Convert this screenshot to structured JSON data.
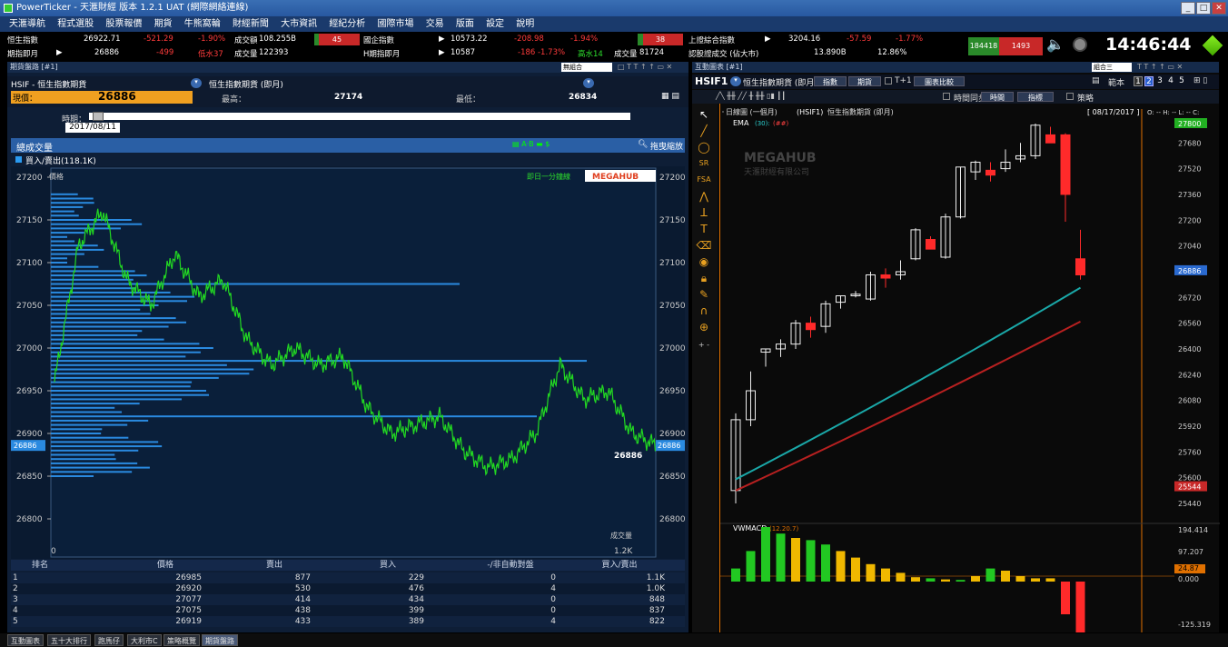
{
  "window": {
    "title": "PowerTicker - 天滙財經 版本 1.2.1 UAT (網際網絡連線)",
    "clock": "14:46:44"
  },
  "menu": [
    "天滙導航",
    "程式選股",
    "股票報價",
    "期貨",
    "牛熊窩輪",
    "財經新聞",
    "大市資訊",
    "經紀分析",
    "國際市場",
    "交易",
    "版面",
    "設定",
    "說明"
  ],
  "ticker": {
    "row1": {
      "l1": "恒生指數",
      "v1": "26922.71",
      "c1": "-521.29",
      "p1": "-1.90%",
      "t1": "成交額",
      "a1": "108.255B",
      "b1": "45",
      "l2": "國企指數",
      "v2": "10573.22",
      "c2": "-208.98",
      "p2": "-1.94%",
      "b2": "38",
      "l3": "上證綜合指數",
      "v3": "3204.16",
      "c3": "-57.59",
      "p3": "-1.77%"
    },
    "row2": {
      "l1": "期指即月",
      "v1": "26886",
      "c1": "-499",
      "p1": "低水37",
      "t1": "成交量",
      "a1": "122393",
      "l2": "H期指即月",
      "v2": "10587",
      "c2": "-186 -1.73%",
      "p2": "高水14",
      "t2": "成交量",
      "a2": "81724",
      "l3": "認股證成交 (佔大市)",
      "v3": "13.890B",
      "p3": "12.86%"
    },
    "counts": {
      "up": "184418",
      "down": "1493"
    }
  },
  "left": {
    "panel_title": "期貨盤路 [#1]",
    "combo": "無組合",
    "symbol": "HSIF - 恒生指數期貨",
    "name": "恒生指數期貨 (即月)",
    "price_label": "現價：",
    "price": "26886",
    "high_label": "最高：",
    "high": "27174",
    "low_label": "最低：",
    "low": "26834",
    "date_label": "時期：",
    "date": "2017/08/11",
    "section": "總成交量",
    "zoom_label": "拖曳縮放",
    "legend": "買入/賣出(118.1K)",
    "y_title": "價格",
    "watermark_brand": "MEGAHUB",
    "watermark_note": "即日一分鐘線",
    "ticks": [
      "27200",
      "27150",
      "27100",
      "27050",
      "27000",
      "26950",
      "26900",
      "26850",
      "26800"
    ],
    "last_marker": "26886",
    "x0": "0",
    "x1": "1.2K",
    "x_title": "成交量",
    "table": {
      "headers": [
        "排名",
        "價格",
        "賣出",
        "買入",
        "-/非自動對盤",
        "買入/賣出"
      ],
      "rows": [
        [
          "1",
          "26985",
          "877",
          "229",
          "0",
          "1.1K"
        ],
        [
          "2",
          "26920",
          "530",
          "476",
          "4",
          "1.0K"
        ],
        [
          "3",
          "27077",
          "414",
          "434",
          "0",
          "848"
        ],
        [
          "4",
          "27075",
          "438",
          "399",
          "0",
          "837"
        ],
        [
          "5",
          "26919",
          "433",
          "389",
          "4",
          "822"
        ]
      ]
    }
  },
  "right": {
    "panel_title": "互動圖表 [#1]",
    "combo": "組合三",
    "symbol": "HSIF1",
    "name": "恒生指數期貨 (即月)",
    "buttons": [
      "指數",
      "期貨",
      "T+1",
      "圖表比較",
      "時間同步",
      "時間",
      "指標",
      "策略",
      "範本"
    ],
    "pages": [
      "1",
      "2",
      "3",
      "4",
      "5"
    ],
    "chart_title": "日線圖 (一個月)",
    "chart_sym": "(HSIF1)",
    "chart_name": "恒生指數期貨 (即月)",
    "chart_date": "[ 08/17/2017 ]",
    "chart_ohlc": "O: -- H: -- L: -- C:",
    "ema_label": "EMA",
    "ema_p1": "(30):",
    "ema_p2": "(##)",
    "brand": "MEGAHUB",
    "brand_sub": "天滙財經有限公司",
    "axis": [
      "27800",
      "27680",
      "27520",
      "27360",
      "27200",
      "27040",
      "26886",
      "26720",
      "26560",
      "26400",
      "26240",
      "26080",
      "25920",
      "25760",
      "25600",
      "25544",
      "25440"
    ],
    "last": "26886",
    "low_marker": "25544",
    "top_marker": "27800",
    "macd_label": "VWMACD",
    "macd_param": "(12.20.7)",
    "macd_axis": [
      "194.414",
      "97.207",
      "24.87",
      "0.000",
      "-125.319"
    ]
  },
  "bottom_tabs": [
    "互動圖表",
    "五十大排行",
    "跑馬仔",
    "大利市C",
    "策略概覽",
    "期貨盤路"
  ],
  "chart_data": {
    "type": "candlestick",
    "series": [
      {
        "o": 25520,
        "h": 26000,
        "l": 25440,
        "c": 25960
      },
      {
        "o": 25960,
        "h": 26260,
        "l": 25920,
        "c": 26140
      },
      {
        "o": 26380,
        "h": 26400,
        "l": 26290,
        "c": 26400
      },
      {
        "o": 26400,
        "h": 26460,
        "l": 26350,
        "c": 26430
      },
      {
        "o": 26430,
        "h": 26580,
        "l": 26400,
        "c": 26560
      },
      {
        "o": 26560,
        "h": 26600,
        "l": 26470,
        "c": 26520
      },
      {
        "o": 26540,
        "h": 26700,
        "l": 26500,
        "c": 26680
      },
      {
        "o": 26690,
        "h": 26730,
        "l": 26650,
        "c": 26730
      },
      {
        "o": 26730,
        "h": 26760,
        "l": 26720,
        "c": 26740
      },
      {
        "o": 26710,
        "h": 26880,
        "l": 26700,
        "c": 26860
      },
      {
        "o": 26860,
        "h": 26900,
        "l": 26780,
        "c": 26840
      },
      {
        "o": 26860,
        "h": 26950,
        "l": 26830,
        "c": 26880
      },
      {
        "o": 26960,
        "h": 27150,
        "l": 26950,
        "c": 27140
      },
      {
        "o": 27080,
        "h": 27100,
        "l": 27020,
        "c": 27020
      },
      {
        "o": 26970,
        "h": 27240,
        "l": 26960,
        "c": 27220
      },
      {
        "o": 27220,
        "h": 27530,
        "l": 27210,
        "c": 27530
      },
      {
        "o": 27500,
        "h": 27570,
        "l": 27450,
        "c": 27560
      },
      {
        "o": 27510,
        "h": 27560,
        "l": 27440,
        "c": 27480
      },
      {
        "o": 27520,
        "h": 27640,
        "l": 27500,
        "c": 27560
      },
      {
        "o": 27580,
        "h": 27680,
        "l": 27560,
        "c": 27600
      },
      {
        "o": 27600,
        "h": 27800,
        "l": 27580,
        "c": 27790
      },
      {
        "o": 27730,
        "h": 27780,
        "l": 27680,
        "c": 27680
      },
      {
        "o": 27730,
        "h": 27740,
        "l": 27190,
        "c": 27360
      },
      {
        "o": 26960,
        "h": 27140,
        "l": 26830,
        "c": 26860
      }
    ]
  }
}
